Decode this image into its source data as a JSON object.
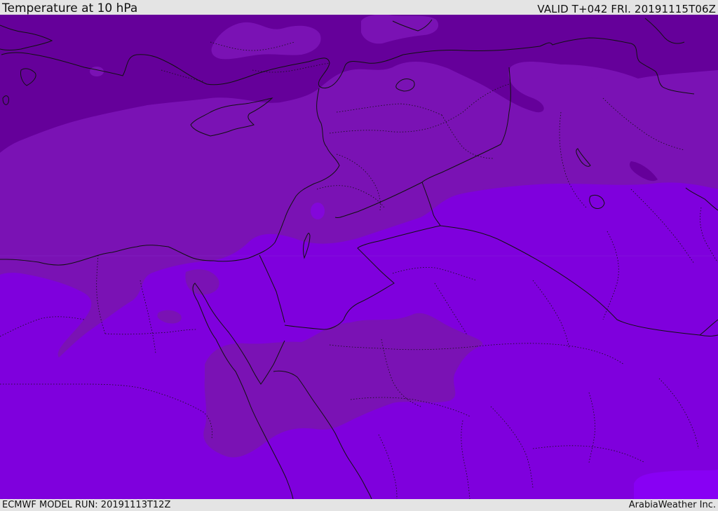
{
  "header": {
    "title": "Temperature at 10 hPa",
    "valid_time": "VALID T+042 FRI. 20191115T06Z"
  },
  "footer": {
    "model_run": "ECMWF MODEL RUN: 20191113T12Z",
    "credit": "ArabiaWeather Inc."
  },
  "map": {
    "field": "temperature",
    "level": "10 hPa",
    "colors": {
      "coldest_band": "#65009a",
      "cold_band": "#7a12b4",
      "base_band": "#7f00dd",
      "warm_spot": "#8800f4",
      "boundaries": "#111111"
    }
  }
}
